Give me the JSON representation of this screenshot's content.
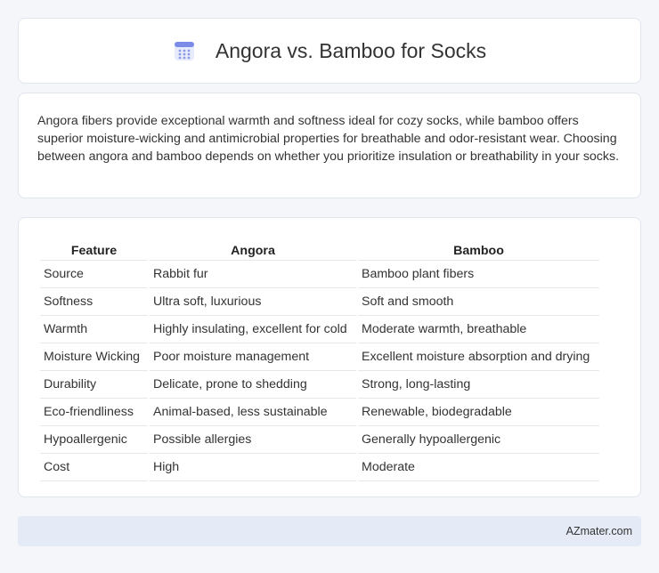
{
  "header": {
    "title": "Angora vs. Bamboo for Socks",
    "icon": "calendar-icon"
  },
  "intro": {
    "text": "Angora fibers provide exceptional warmth and softness ideal for cozy socks, while bamboo offers superior moisture-wicking and antimicrobial properties for breathable and odor-resistant wear. Choosing between angora and bamboo depends on whether you prioritize insulation or breathability in your socks."
  },
  "table": {
    "headers": [
      "Feature",
      "Angora",
      "Bamboo"
    ],
    "rows": [
      [
        "Source",
        "Rabbit fur",
        "Bamboo plant fibers"
      ],
      [
        "Softness",
        "Ultra soft, luxurious",
        "Soft and smooth"
      ],
      [
        "Warmth",
        "Highly insulating, excellent for cold",
        "Moderate warmth, breathable"
      ],
      [
        "Moisture Wicking",
        "Poor moisture management",
        "Excellent moisture absorption and drying"
      ],
      [
        "Durability",
        "Delicate, prone to shedding",
        "Strong, long-lasting"
      ],
      [
        "Eco-friendliness",
        "Animal-based, less sustainable",
        "Renewable, biodegradable"
      ],
      [
        "Hypoallergenic",
        "Possible allergies",
        "Generally hypoallergenic"
      ],
      [
        "Cost",
        "High",
        "Moderate"
      ]
    ]
  },
  "footer": {
    "site": "AZmater.com"
  }
}
